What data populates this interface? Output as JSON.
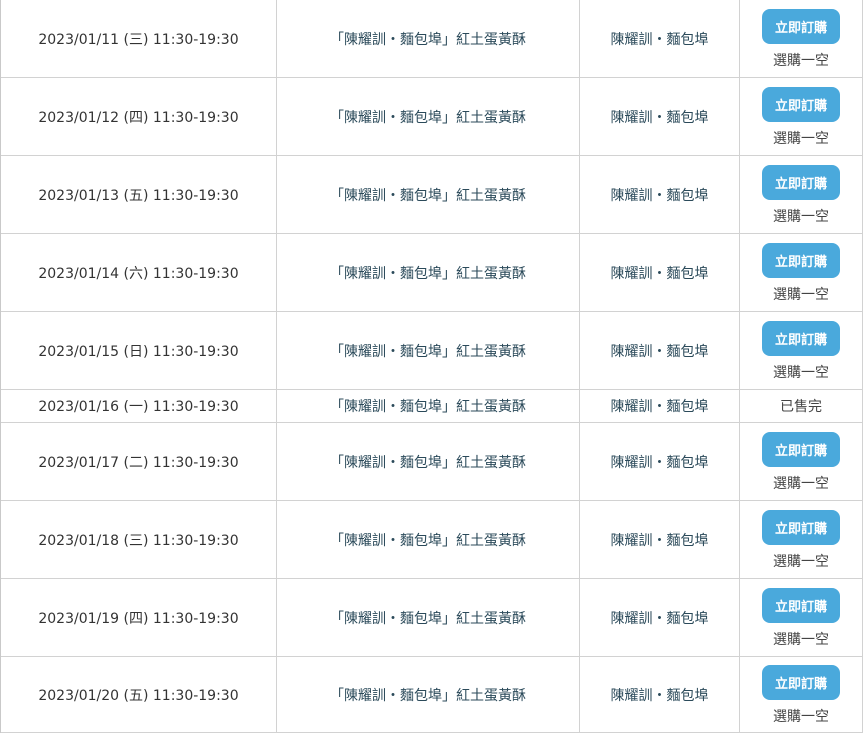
{
  "rows": [
    {
      "date": "2023/01/11 (三) 11:30-19:30",
      "product": "「陳耀訓・麵包埠」紅土蛋黃酥",
      "vendor": "陳耀訓・麵包埠",
      "button": "立即訂購",
      "status": "選購一空"
    },
    {
      "date": "2023/01/12 (四) 11:30-19:30",
      "product": "「陳耀訓・麵包埠」紅土蛋黃酥",
      "vendor": "陳耀訓・麵包埠",
      "button": "立即訂購",
      "status": "選購一空"
    },
    {
      "date": "2023/01/13 (五) 11:30-19:30",
      "product": "「陳耀訓・麵包埠」紅土蛋黃酥",
      "vendor": "陳耀訓・麵包埠",
      "button": "立即訂購",
      "status": "選購一空"
    },
    {
      "date": "2023/01/14 (六) 11:30-19:30",
      "product": "「陳耀訓・麵包埠」紅土蛋黃酥",
      "vendor": "陳耀訓・麵包埠",
      "button": "立即訂購",
      "status": "選購一空"
    },
    {
      "date": "2023/01/15 (日) 11:30-19:30",
      "product": "「陳耀訓・麵包埠」紅土蛋黃酥",
      "vendor": "陳耀訓・麵包埠",
      "button": "立即訂購",
      "status": "選購一空"
    },
    {
      "date": "2023/01/16 (一) 11:30-19:30",
      "product": "「陳耀訓・麵包埠」紅土蛋黃酥",
      "vendor": "陳耀訓・麵包埠",
      "soldout": "已售完"
    },
    {
      "date": "2023/01/17 (二) 11:30-19:30",
      "product": "「陳耀訓・麵包埠」紅土蛋黃酥",
      "vendor": "陳耀訓・麵包埠",
      "button": "立即訂購",
      "status": "選購一空"
    },
    {
      "date": "2023/01/18 (三) 11:30-19:30",
      "product": "「陳耀訓・麵包埠」紅土蛋黃酥",
      "vendor": "陳耀訓・麵包埠",
      "button": "立即訂購",
      "status": "選購一空"
    },
    {
      "date": "2023/01/19 (四) 11:30-19:30",
      "product": "「陳耀訓・麵包埠」紅土蛋黃酥",
      "vendor": "陳耀訓・麵包埠",
      "button": "立即訂購",
      "status": "選購一空"
    },
    {
      "date": "2023/01/20 (五) 11:30-19:30",
      "product": "「陳耀訓・麵包埠」紅土蛋黃酥",
      "vendor": "陳耀訓・麵包埠",
      "button": "立即訂購",
      "status": "選購一空"
    }
  ],
  "colors": {
    "button_bg": "#4aa9dc",
    "button_text": "#ffffff",
    "border": "#d2d2d2",
    "product_text": "#2b4a5a"
  }
}
